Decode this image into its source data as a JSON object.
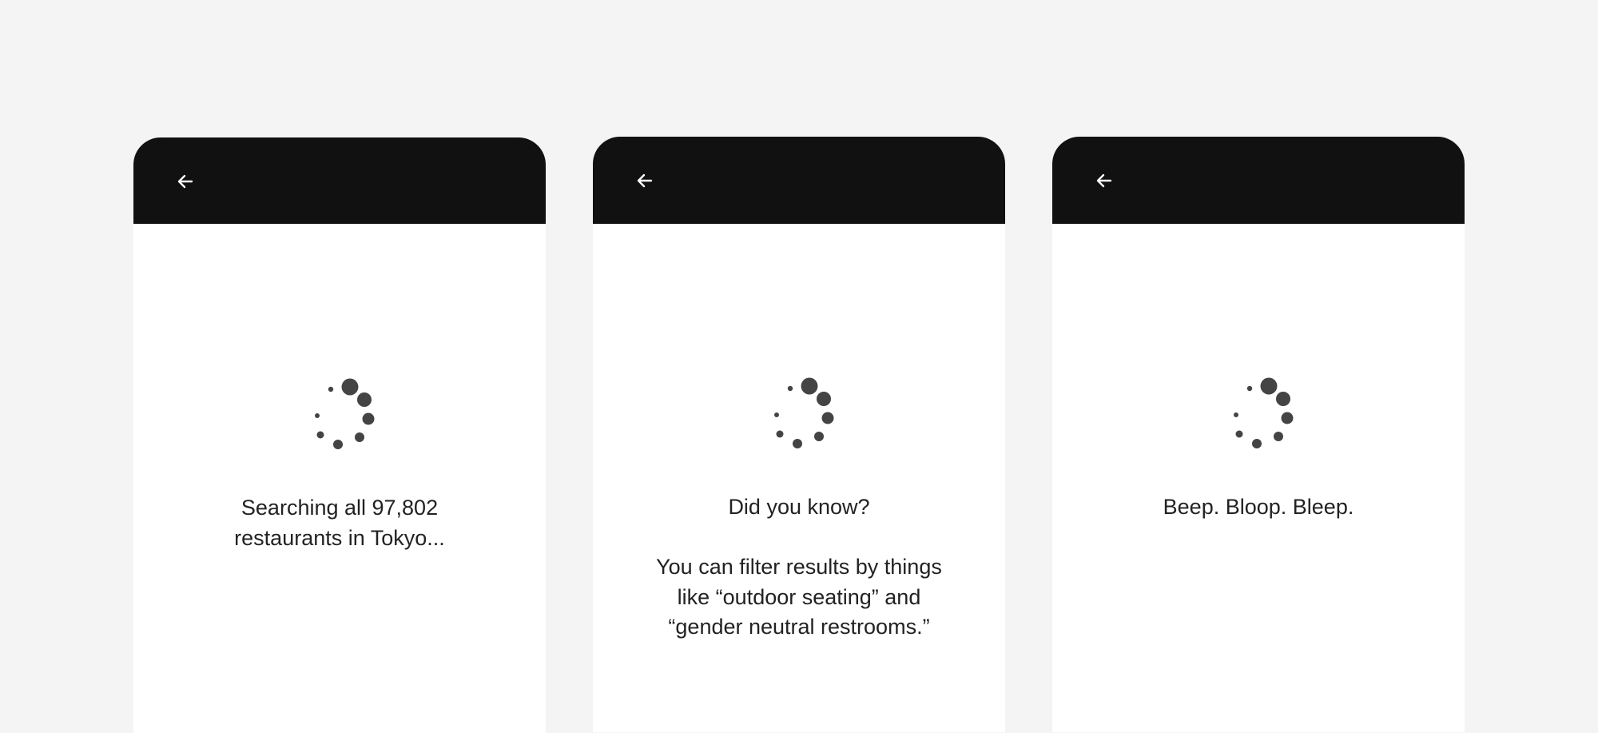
{
  "screens": [
    {
      "back_label": "Back",
      "messages": [
        "Searching all 97,802\nrestaurants in Tokyo..."
      ]
    },
    {
      "back_label": "Back",
      "messages": [
        "Did you know?",
        "You can filter results by things\nlike “outdoor seating” and\n“gender neutral restrooms.”"
      ]
    },
    {
      "back_label": "Back",
      "messages": [
        "Beep. Bloop. Bleep."
      ]
    }
  ],
  "icons": {
    "back": "arrow-left-icon",
    "loading": "loading-spinner-icon"
  },
  "colors": {
    "page_background": "#f4f4f4",
    "header_background": "#111111",
    "screen_background": "#ffffff",
    "spinner": "#444444",
    "text": "#222222",
    "icon": "#ffffff"
  }
}
